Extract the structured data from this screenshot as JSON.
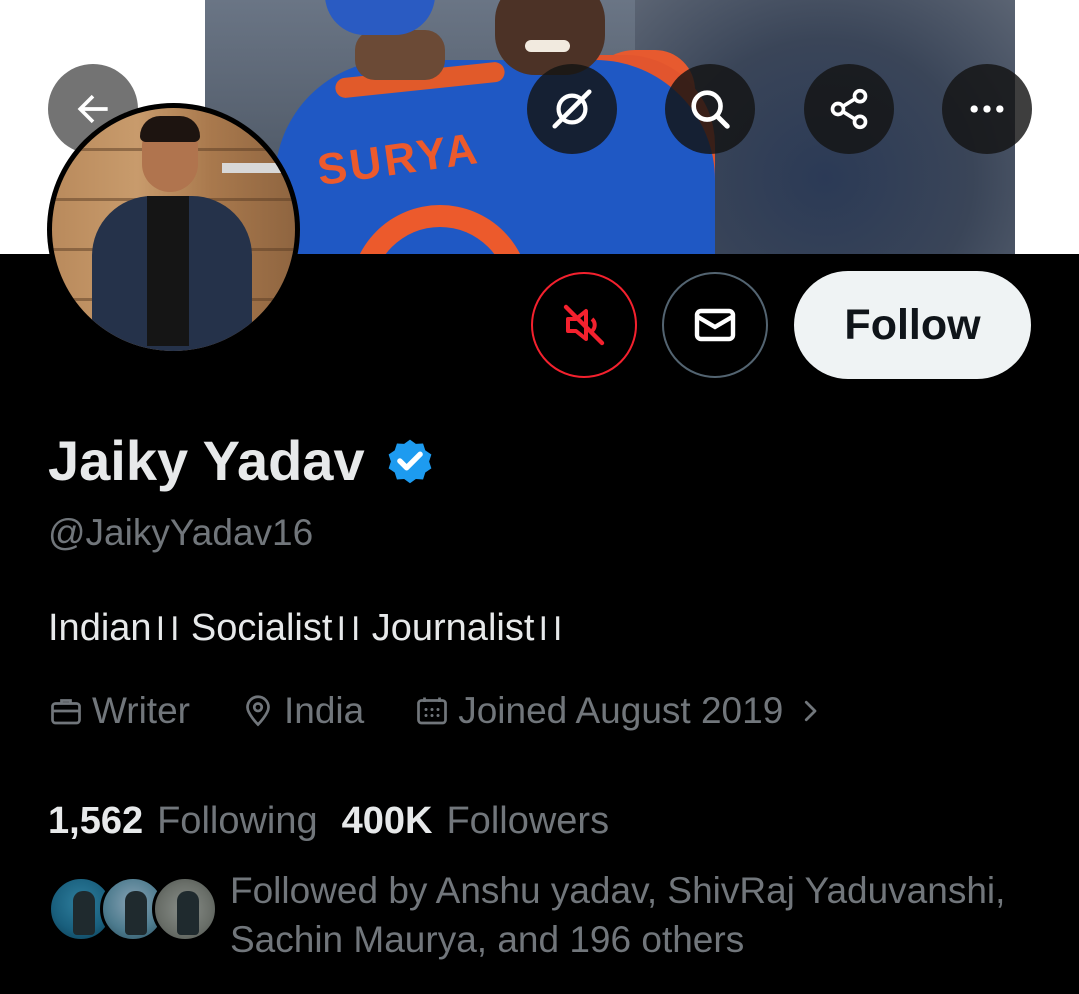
{
  "header": {
    "back_icon": "arrow-left-icon",
    "grok_icon": "grok-icon",
    "search_icon": "search-icon",
    "share_icon": "share-icon",
    "more_icon": "more-horizontal-icon"
  },
  "banner": {
    "jersey_text": "SURYA"
  },
  "actions": {
    "mute_icon": "speaker-muted-icon",
    "message_icon": "envelope-icon",
    "follow_label": "Follow"
  },
  "profile": {
    "display_name": "Jaiky Yadav",
    "handle": "@JaikyYadav16",
    "bio": "Indian।। Socialist।। Journalist।।",
    "profession": "Writer",
    "location": "India",
    "joined": "Joined August 2019"
  },
  "stats": {
    "following_count": "1,562",
    "following_label": "Following",
    "followers_count": "400K",
    "followers_label": "Followers"
  },
  "followed_by": {
    "text": "Followed by Anshu yadav, ShivRaj Yaduvanshi, Sachin Maurya, and 196 others"
  },
  "colors": {
    "background": "#000000",
    "verified_blue": "#1d9bf0",
    "mute_red": "#f4212e",
    "muted_text": "#71767b",
    "primary_text": "#e7e9ea",
    "follow_button_bg": "#eff3f4"
  }
}
